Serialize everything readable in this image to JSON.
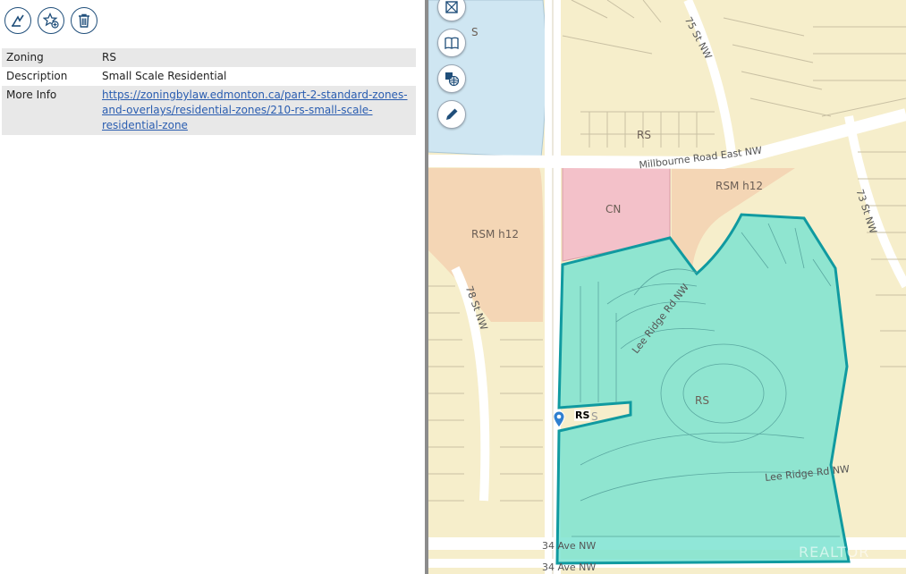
{
  "toolbar": {
    "buttons": [
      {
        "name": "zoom-to-feature-button",
        "icon": "zoom-to-icon"
      },
      {
        "name": "add-favorite-button",
        "icon": "star-add-icon"
      },
      {
        "name": "delete-button",
        "icon": "trash-icon"
      }
    ]
  },
  "info": {
    "rows": [
      {
        "key": "Zoning",
        "value": "RS"
      },
      {
        "key": "Description",
        "value": "Small Scale Residential"
      },
      {
        "key": "More Info",
        "value": "https://zoningbylaw.edmonton.ca/part-2-standard-zones-and-overlays/residential-zones/210-rs-small-scale-residential-zone"
      }
    ],
    "link_lines": [
      "https://zoningbylaw.edmonton.ca/part-2-standard-zones-",
      "and-overlays/residential-zones/210-rs-small-scale-",
      "residential-zone"
    ]
  },
  "map": {
    "tools": [
      {
        "name": "basemap-button",
        "icon": "layers-icon"
      },
      {
        "name": "legend-button",
        "icon": "book-icon"
      },
      {
        "name": "web-layers-button",
        "icon": "globe-layers-icon"
      },
      {
        "name": "draw-button",
        "icon": "pencil-icon"
      }
    ],
    "zone_labels": {
      "rs_top": "RS",
      "rsm_top": "RSM h12",
      "cn": "CN",
      "rsm_left": "RSM h12",
      "rs_center": "RS",
      "partial_top": "S"
    },
    "streets": {
      "millbourne": "Millbourne Road East NW",
      "st75": "75 St NW",
      "st73": "73 St NW",
      "st78": "78 St NW",
      "lee_ridge_1": "Lee Ridge Rd NW",
      "lee_ridge_2": "Lee Ridge Rd NW",
      "ave34_a": "34 Ave NW",
      "ave34_b": "34 Ave NW"
    },
    "pin_label": "RS",
    "pin_label_ghost": "S",
    "watermark": "REALTOR",
    "colors": {
      "rs_highlight": "#7de3d1",
      "rs_outline": "#109aa0",
      "commercial": "#f3c1c9",
      "rsm": "#f4d6b5",
      "institutional": "#cfe6f2",
      "road": "#ffffff",
      "background": "#f6eecb"
    }
  }
}
